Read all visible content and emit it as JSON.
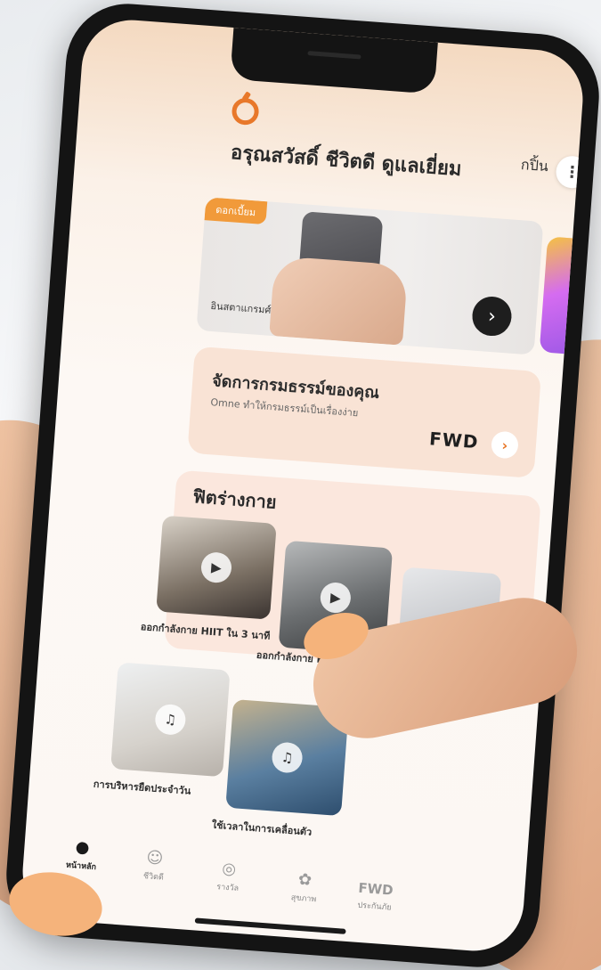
{
  "app": {
    "greeting": "อรุณสวัสดิ์ ชีวิตดี ดูแลเยี่ยม",
    "header_button_label": "กปิ้น",
    "more_icon": "more-vertical-icon"
  },
  "hero": {
    "tag": "ดอกเบี้ยม",
    "caption": "อินสตาแกรมศ์",
    "next_icon": "chevron-right-icon"
  },
  "policy": {
    "title": "จัดการกรมธรรม์ของคุณ",
    "subtitle": "Omne ทำให้กรมธรรม์เป็นเรื่องง่าย",
    "brand": "FWD"
  },
  "fitness": {
    "title": "ฟิตร่างกาย",
    "items": [
      {
        "caption": "ออกกำลังกาย HIIT ใน 3 นาที",
        "badge": "video-icon"
      },
      {
        "caption": "ออกกำลังกาย HIIT ใน 6 นาที",
        "badge": "video-icon"
      },
      {
        "caption": "",
        "badge": "video-icon"
      },
      {
        "caption": "การบริหารยืดประจำวัน",
        "badge": "music-icon"
      },
      {
        "caption": "ใช้เวลาในการเคลื่อนตัว",
        "badge": "music-icon"
      }
    ]
  },
  "nav": {
    "items": [
      {
        "label": "หน้าหลัก",
        "icon": "home-icon",
        "active": true
      },
      {
        "label": "ชีวิตดี",
        "icon": "community-icon",
        "active": false
      },
      {
        "label": "รางวัล",
        "icon": "rewards-icon",
        "active": false
      },
      {
        "label": "สุขภาพ",
        "icon": "health-icon",
        "active": false
      },
      {
        "label": "ประกันภัย",
        "icon": "fwd-icon",
        "active": false
      }
    ],
    "fwd_text": "FWD"
  },
  "colors": {
    "brand_orange": "#e8782a",
    "accent_peach": "#f5b37b",
    "phone_frame": "#141414"
  }
}
